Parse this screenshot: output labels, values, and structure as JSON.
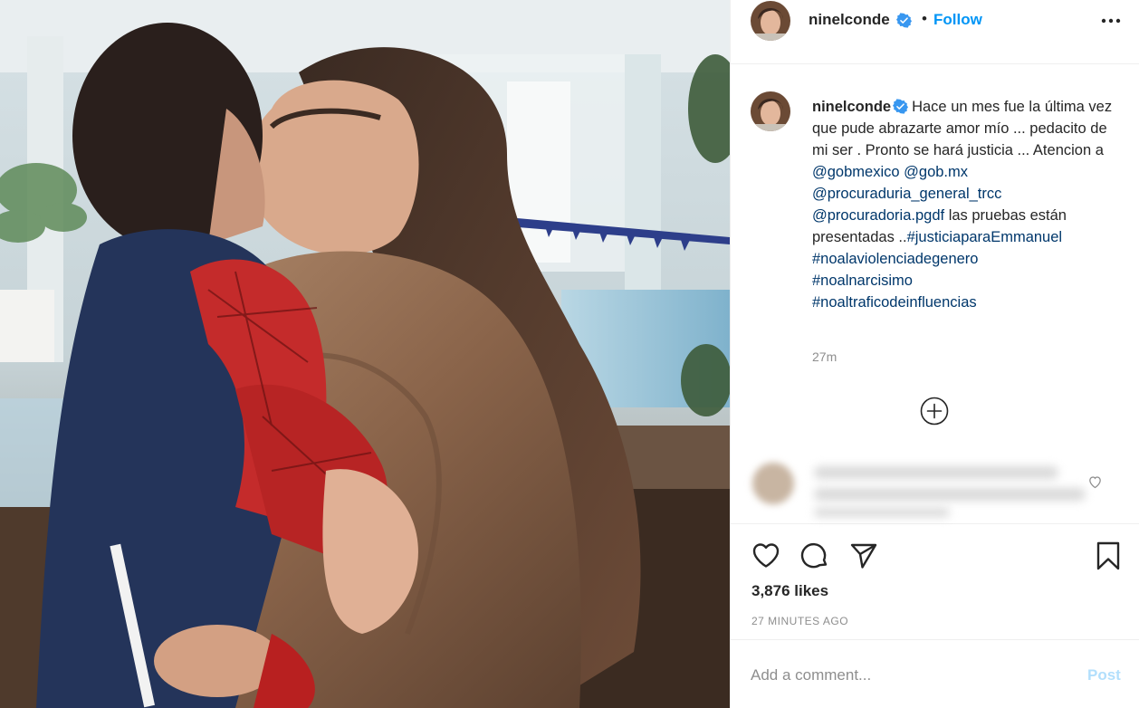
{
  "post": {
    "image_alt": "",
    "author": {
      "username": "ninelconde",
      "verified": true,
      "follow_label": "Follow",
      "separator": "•"
    },
    "caption": {
      "username": "ninelconde",
      "text_intro": "Hace un mes fue la última vez que pude abrazarte amor mío ... pedacito de mi ser . Pronto se hará justicia ... Atencion a",
      "mention_1": "@gobmexico",
      "mention_2": "@gob.mx",
      "mention_3": "@procuraduria_general_trcc",
      "mention_4": "@procuradoria.pgdf",
      "text_mid": "las pruebas están presentadas ..",
      "hashtag_1": "#justiciaparaEmmanuel",
      "hashtag_2": "#noalaviolenciadegenero",
      "hashtag_3": "#noalnarcisimo",
      "hashtag_4": "#noaltraficodeinfluencias",
      "time_ago": "27m"
    },
    "likes": "3,876 likes",
    "timestamp": "27 MINUTES AGO",
    "comment": {
      "placeholder": "Add a comment...",
      "post_label": "Post"
    }
  },
  "icons": {
    "more": "more-options-icon",
    "verified": "verified-badge-icon",
    "load_more": "plus-circle-icon",
    "like": "heart-icon",
    "comment": "comment-bubble-icon",
    "share": "paper-plane-icon",
    "save": "bookmark-icon"
  },
  "colors": {
    "link_blue": "#0095f6",
    "tag_blue": "#00376b",
    "post_disabled": "#b2dffc",
    "muted": "#8e8e8e",
    "text": "#262626"
  }
}
